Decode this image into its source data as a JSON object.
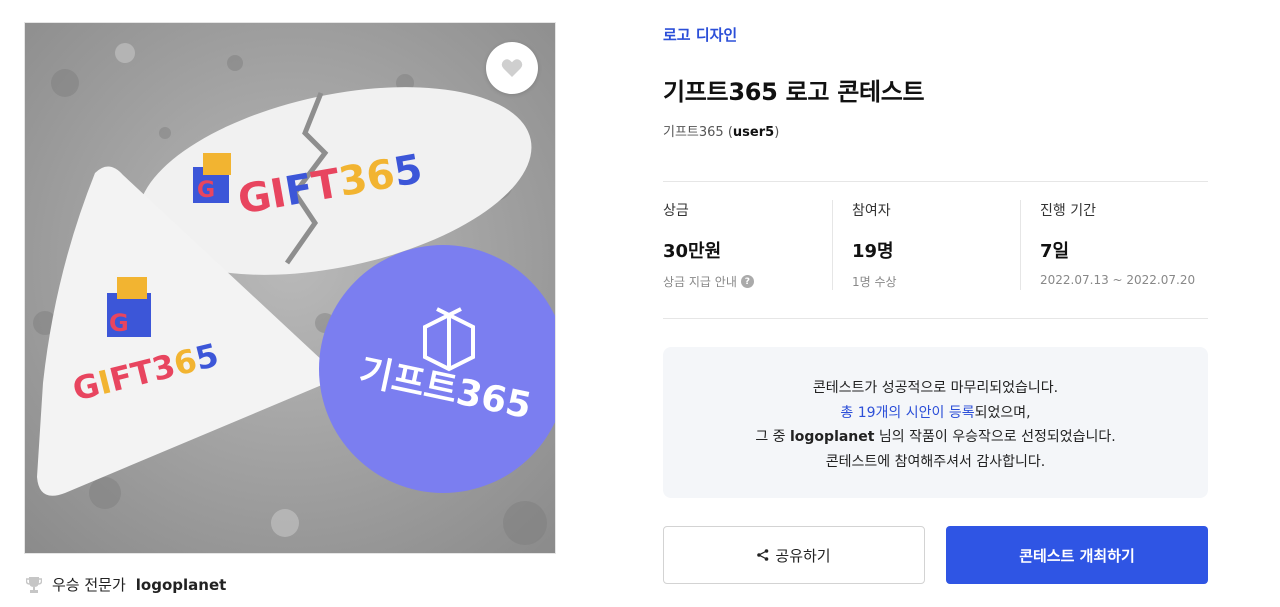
{
  "category": "로고 디자인",
  "title": "기프트365 로고 콘테스트",
  "host": {
    "name": "기프트365",
    "user_id": "user5"
  },
  "stats": [
    {
      "label": "상금",
      "value": "30만원",
      "sub": "상금 지급 안내"
    },
    {
      "label": "참여자",
      "value": "19명",
      "sub": "1명 수상"
    },
    {
      "label": "진행 기간",
      "value": "7일",
      "sub": "2022.07.13 ~ 2022.07.20"
    }
  ],
  "notice": {
    "line1": "콘테스트가 성공적으로 마무리되었습니다.",
    "line2_link": "총 19개의 시안이 등록",
    "line2_rest": "되었으며,",
    "line3_pre": "그 중 ",
    "line3_name": "logoplanet",
    "line3_post": " 님의 작품이 우승작으로 선정되었습니다.",
    "line4": "콘테스트에 참여해주셔서 감사합니다."
  },
  "buttons": {
    "share": "공유하기",
    "host_contest": "콘테스트 개최하기"
  },
  "winner": {
    "prefix": "우승 전문가",
    "name": "logoplanet"
  },
  "artwork": {
    "logo_text": "GIFT365",
    "logo_text_kr": "기프트365",
    "logo_chars": [
      "G",
      "I",
      "F",
      "T",
      "3",
      "6",
      "5"
    ],
    "logo_char_colors": [
      "#e8455f",
      "#e8455f",
      "#3c56d8",
      "#e8455f",
      "#f2b431",
      "#f2b431",
      "#3c56d8"
    ]
  },
  "colors": {
    "accent": "#2c4fd8",
    "primary_button": "#2f55e4",
    "sticker_circle": "#7b7ef0"
  },
  "icons": {
    "favorite": "heart-icon",
    "share": "share-icon",
    "trophy": "trophy-icon",
    "help": "question-icon"
  }
}
